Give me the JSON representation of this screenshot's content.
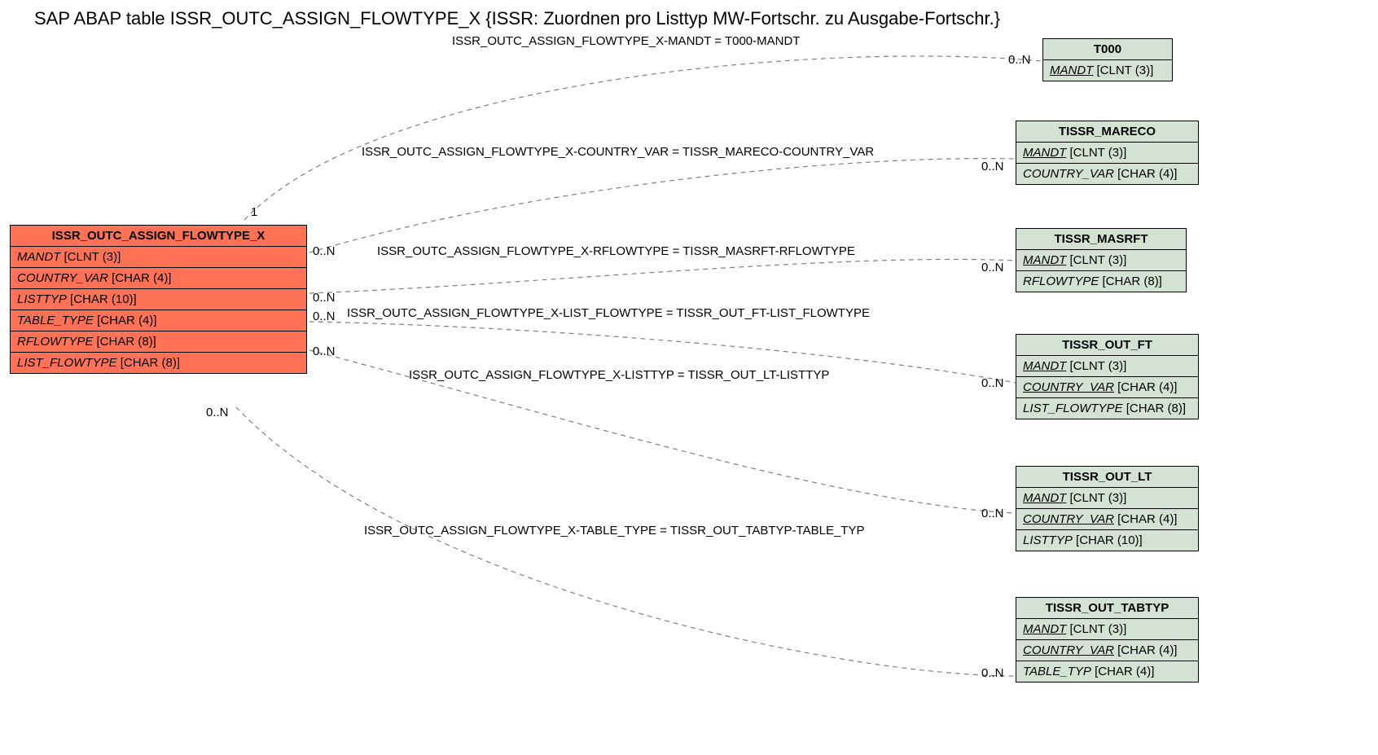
{
  "title": "SAP ABAP table ISSR_OUTC_ASSIGN_FLOWTYPE_X {ISSR: Zuordnen pro Listtyp MW-Fortschr. zu Ausgabe-Fortschr.}",
  "mainTable": {
    "name": "ISSR_OUTC_ASSIGN_FLOWTYPE_X",
    "fields": [
      {
        "name": "MANDT",
        "type": "[CLNT (3)]"
      },
      {
        "name": "COUNTRY_VAR",
        "type": "[CHAR (4)]"
      },
      {
        "name": "LISTTYP",
        "type": "[CHAR (10)]"
      },
      {
        "name": "TABLE_TYPE",
        "type": "[CHAR (4)]"
      },
      {
        "name": "RFLOWTYPE",
        "type": "[CHAR (8)]"
      },
      {
        "name": "LIST_FLOWTYPE",
        "type": "[CHAR (8)]"
      }
    ]
  },
  "refTables": [
    {
      "name": "T000",
      "fields": [
        {
          "name": "MANDT",
          "type": "[CLNT (3)]",
          "underline": true
        }
      ]
    },
    {
      "name": "TISSR_MARECO",
      "fields": [
        {
          "name": "MANDT",
          "type": "[CLNT (3)]",
          "underline": true
        },
        {
          "name": "COUNTRY_VAR",
          "type": "[CHAR (4)]"
        }
      ]
    },
    {
      "name": "TISSR_MASRFT",
      "fields": [
        {
          "name": "MANDT",
          "type": "[CLNT (3)]",
          "underline": true
        },
        {
          "name": "RFLOWTYPE",
          "type": "[CHAR (8)]"
        }
      ]
    },
    {
      "name": "TISSR_OUT_FT",
      "fields": [
        {
          "name": "MANDT",
          "type": "[CLNT (3)]",
          "underline": true
        },
        {
          "name": "COUNTRY_VAR",
          "type": "[CHAR (4)]",
          "underline": true
        },
        {
          "name": "LIST_FLOWTYPE",
          "type": "[CHAR (8)]"
        }
      ]
    },
    {
      "name": "TISSR_OUT_LT",
      "fields": [
        {
          "name": "MANDT",
          "type": "[CLNT (3)]",
          "underline": true
        },
        {
          "name": "COUNTRY_VAR",
          "type": "[CHAR (4)]",
          "underline": true
        },
        {
          "name": "LISTTYP",
          "type": "[CHAR (10)]"
        }
      ]
    },
    {
      "name": "TISSR_OUT_TABTYP",
      "fields": [
        {
          "name": "MANDT",
          "type": "[CLNT (3)]",
          "underline": true
        },
        {
          "name": "COUNTRY_VAR",
          "type": "[CHAR (4)]",
          "underline": true
        },
        {
          "name": "TABLE_TYP",
          "type": "[CHAR (4)]"
        }
      ]
    }
  ],
  "relations": [
    "ISSR_OUTC_ASSIGN_FLOWTYPE_X-MANDT = T000-MANDT",
    "ISSR_OUTC_ASSIGN_FLOWTYPE_X-COUNTRY_VAR = TISSR_MARECO-COUNTRY_VAR",
    "ISSR_OUTC_ASSIGN_FLOWTYPE_X-RFLOWTYPE = TISSR_MASRFT-RFLOWTYPE",
    "ISSR_OUTC_ASSIGN_FLOWTYPE_X-LIST_FLOWTYPE = TISSR_OUT_FT-LIST_FLOWTYPE",
    "ISSR_OUTC_ASSIGN_FLOWTYPE_X-LISTTYP = TISSR_OUT_LT-LISTTYP",
    "ISSR_OUTC_ASSIGN_FLOWTYPE_X-TABLE_TYPE = TISSR_OUT_TABTYP-TABLE_TYP"
  ],
  "card": {
    "main1": "1",
    "zeroN": "0..N"
  }
}
